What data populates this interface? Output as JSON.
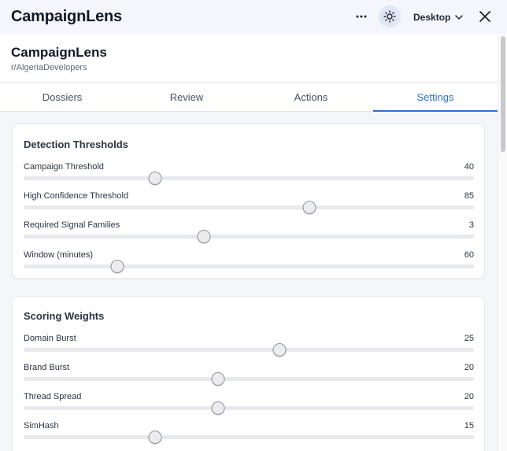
{
  "titlebar": {
    "title": "CampaignLens",
    "more_icon": "more-horizontal-icon",
    "theme_icon": "sun-icon",
    "device_label": "Desktop",
    "close_icon": "close-icon"
  },
  "header": {
    "title": "CampaignLens",
    "subreddit": "r/AlgeriaDevelopers"
  },
  "tabs": [
    {
      "label": "Dossiers",
      "active": false
    },
    {
      "label": "Review",
      "active": false
    },
    {
      "label": "Actions",
      "active": false
    },
    {
      "label": "Settings",
      "active": true
    }
  ],
  "colors": {
    "accent": "#2f6fd6"
  },
  "sections": [
    {
      "title": "Detection Thresholds",
      "sliders": [
        {
          "label": "Campaign Threshold",
          "value": "40",
          "fraction": 0.292
        },
        {
          "label": "High Confidence Threshold",
          "value": "85",
          "fraction": 0.635
        },
        {
          "label": "Required Signal Families",
          "value": "3",
          "fraction": 0.4
        },
        {
          "label": "Window (minutes)",
          "value": "60",
          "fraction": 0.208
        }
      ]
    },
    {
      "title": "Scoring Weights",
      "sliders": [
        {
          "label": "Domain Burst",
          "value": "25",
          "fraction": 0.568
        },
        {
          "label": "Brand Burst",
          "value": "20",
          "fraction": 0.431
        },
        {
          "label": "Thread Spread",
          "value": "20",
          "fraction": 0.431
        },
        {
          "label": "SimHash",
          "value": "15",
          "fraction": 0.292
        }
      ]
    }
  ]
}
